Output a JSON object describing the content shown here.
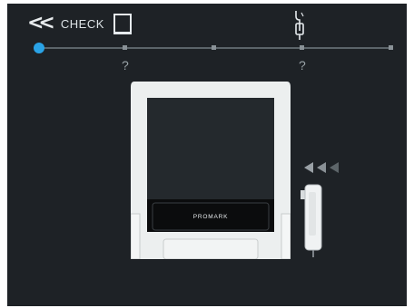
{
  "header": {
    "back_icon": "double-chevron-left-icon",
    "back_label": "CHECK"
  },
  "steps": [
    {
      "icon": "tablet-display-icon",
      "status": "?"
    },
    {
      "icon": "power-plug-cable-icon",
      "status": "?"
    }
  ],
  "progress": {
    "current_step": 1,
    "total_steps": 4
  },
  "device": {
    "brand": "PROMARK"
  },
  "colors": {
    "background": "#1e2226",
    "accent": "#2aa3e6",
    "track": "#5b6469"
  }
}
